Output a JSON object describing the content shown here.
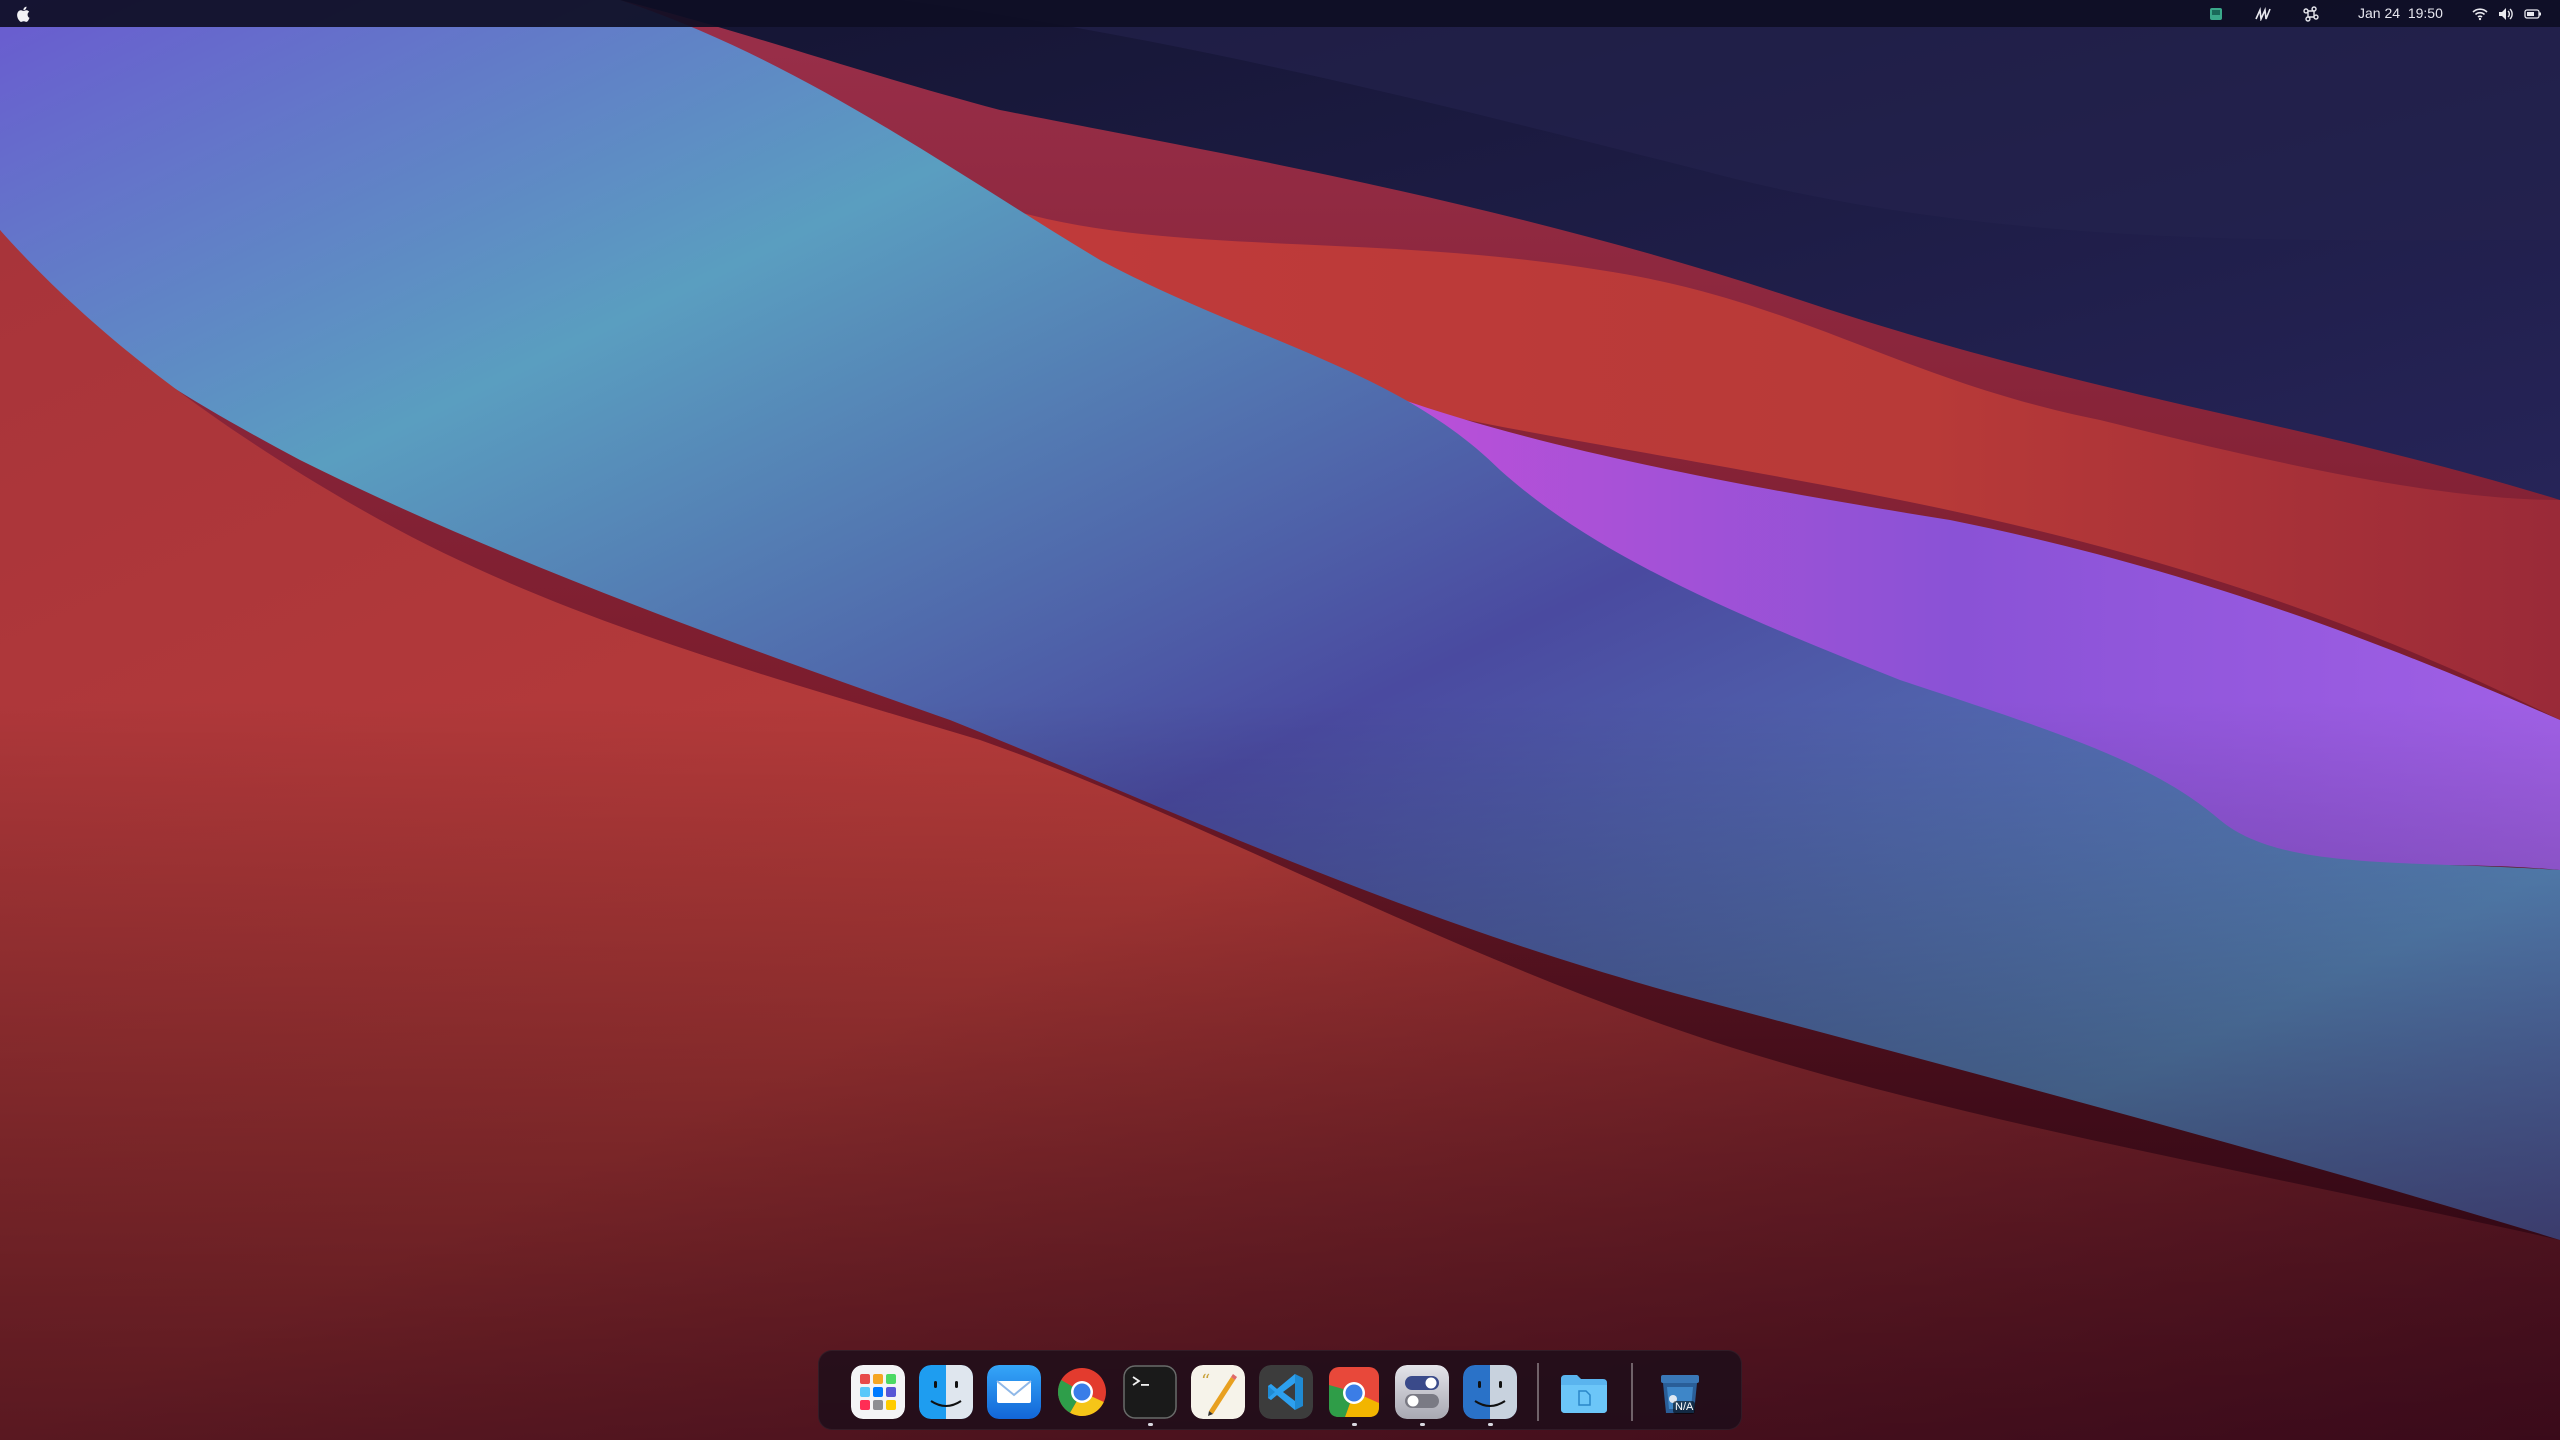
{
  "menubar": {
    "apple_icon": "apple-logo-icon",
    "tray_icons": [
      "green-square-app-icon",
      "pen-scribble-icon",
      "command-key-icon",
      "wifi-icon",
      "volume-icon",
      "battery-icon"
    ],
    "date": "Jan 24",
    "time": "19:50"
  },
  "dock": {
    "apps": [
      {
        "name": "Launchpad",
        "icon": "launchpad-icon",
        "running": false
      },
      {
        "name": "Finder",
        "icon": "finder-icon",
        "running": false
      },
      {
        "name": "Mail",
        "icon": "mail-icon",
        "running": false
      },
      {
        "name": "Google Chrome",
        "icon": "chrome-icon",
        "running": false
      },
      {
        "name": "Terminal",
        "icon": "terminal-icon",
        "running": true
      },
      {
        "name": "Text Editor",
        "icon": "text-editor-icon",
        "running": false
      },
      {
        "name": "Visual Studio Code",
        "icon": "vscode-icon",
        "running": false
      },
      {
        "name": "Chromium",
        "icon": "chromium-icon",
        "running": true
      },
      {
        "name": "Settings",
        "icon": "settings-toggles-icon",
        "running": true
      },
      {
        "name": "Finder",
        "icon": "finder-2-icon",
        "running": true
      }
    ],
    "folder": {
      "name": "Files",
      "icon": "folder-icon"
    },
    "trash": {
      "name": "Trash",
      "icon": "trash-icon",
      "label": "N/A"
    }
  },
  "colors": {
    "menubar_bg": "#0e0e24",
    "dock_bg": "#1c0e1a",
    "wallpaper_red": "#b83a3a",
    "wallpaper_blue": "#5a9ec0",
    "wallpaper_purple": "#9a58e0",
    "wallpaper_navy": "#1e1f48"
  }
}
